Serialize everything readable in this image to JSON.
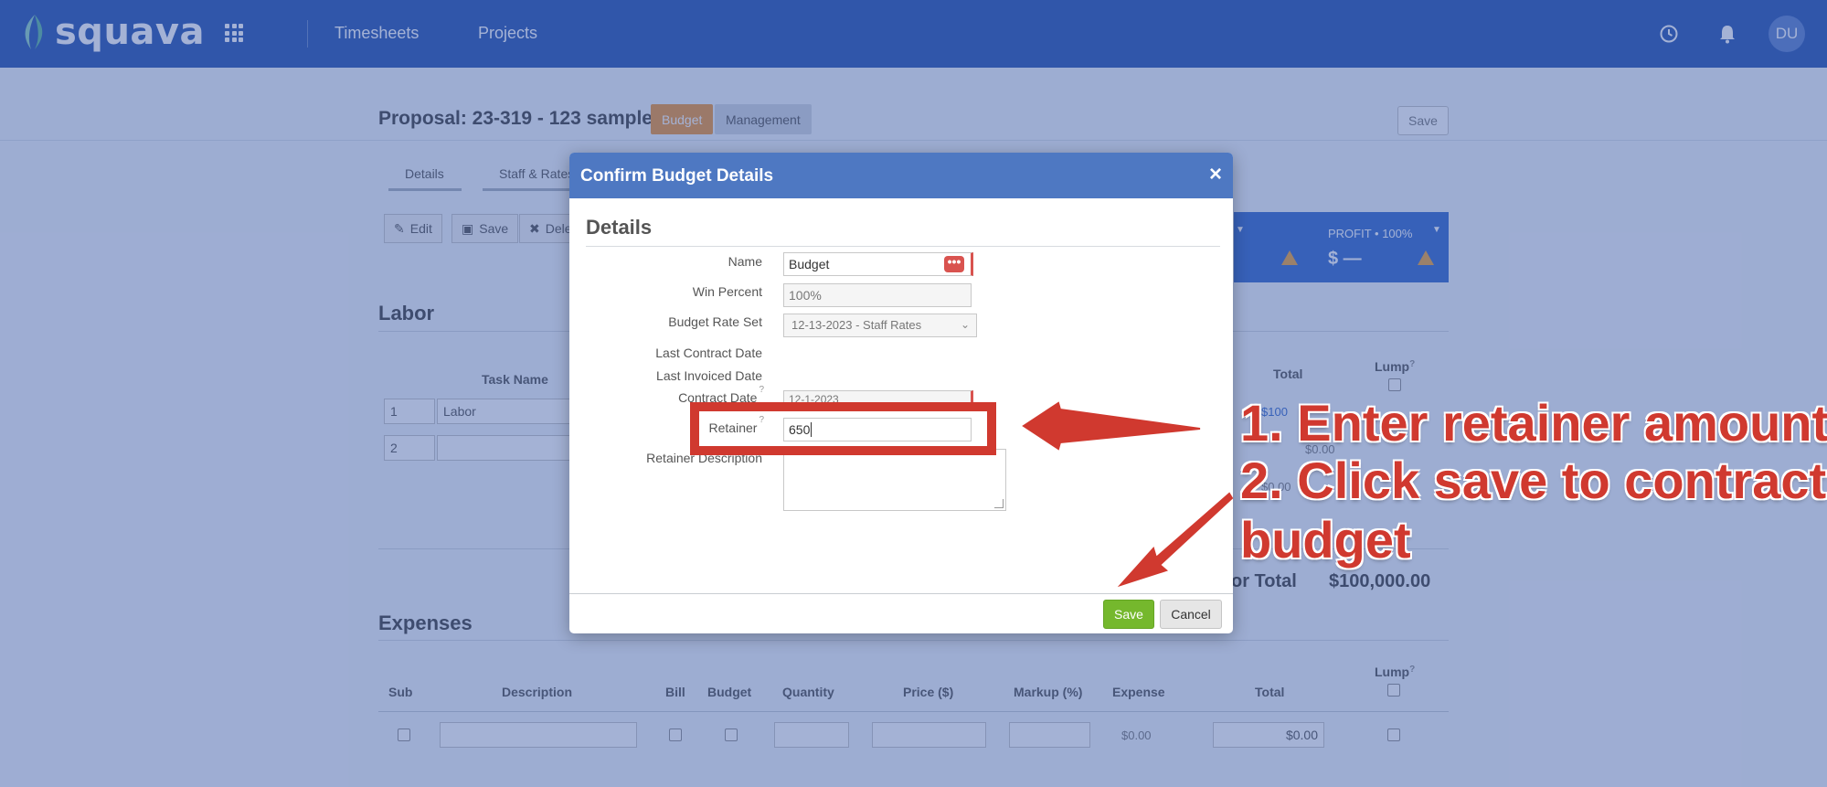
{
  "app": {
    "logo_text": "squava",
    "nav": [
      "Timesheets",
      "Projects"
    ],
    "avatar_initials": "DU",
    "accent_color": "#3f66b8"
  },
  "page": {
    "title": "Proposal: 23-319 - 123 sample",
    "pills": {
      "budget": "Budget",
      "management": "Management"
    },
    "save_label": "Save",
    "subtabs": [
      "Details",
      "Staff & Rates"
    ],
    "toolbar": {
      "edit": "Edit",
      "save": "Save",
      "delete": "Dele"
    },
    "profit": {
      "label": "PROFIT  •  100%",
      "value": "$ —"
    }
  },
  "labor": {
    "title": "Labor",
    "headers": {
      "task_name": "Task Name",
      "total": "Total",
      "lump": "Lump"
    },
    "qmark": "?",
    "rows": [
      {
        "num": "1",
        "task": "Labor",
        "total": "$100"
      },
      {
        "num": "2",
        "task": "",
        "total": "$0.00"
      }
    ],
    "partial_total": "$0.00",
    "total_label": "or Total",
    "total_value": "$100,000.00"
  },
  "expenses": {
    "title": "Expenses",
    "headers": [
      "Sub",
      "Description",
      "Bill",
      "Budget",
      "Quantity",
      "Price ($)",
      "Markup (%)",
      "Expense",
      "Total",
      "Lump"
    ],
    "row": {
      "expense": "$0.00",
      "total": "$0.00"
    }
  },
  "modal": {
    "title": "Confirm Budget Details",
    "close": "×",
    "section": "Details",
    "fields": {
      "name": {
        "label": "Name",
        "value": "Budget",
        "dots": "•••"
      },
      "win_percent": {
        "label": "Win Percent",
        "value": "100%"
      },
      "rate_set": {
        "label": "Budget Rate Set",
        "value": "12-13-2023 - Staff Rates"
      },
      "last_contract": {
        "label": "Last Contract Date"
      },
      "last_invoiced": {
        "label": "Last Invoiced Date"
      },
      "contract_date": {
        "label": "Contract Date",
        "value": "12-1-2023"
      },
      "retainer": {
        "label": "Retainer",
        "value": "650"
      },
      "retainer_desc": {
        "label": "Retainer Description"
      }
    },
    "save": "Save",
    "cancel": "Cancel"
  },
  "annotations": {
    "line1": "1. Enter retainer amount",
    "line2": "2. Click save to contract",
    "line3": "budget",
    "color": "#d0392f"
  }
}
